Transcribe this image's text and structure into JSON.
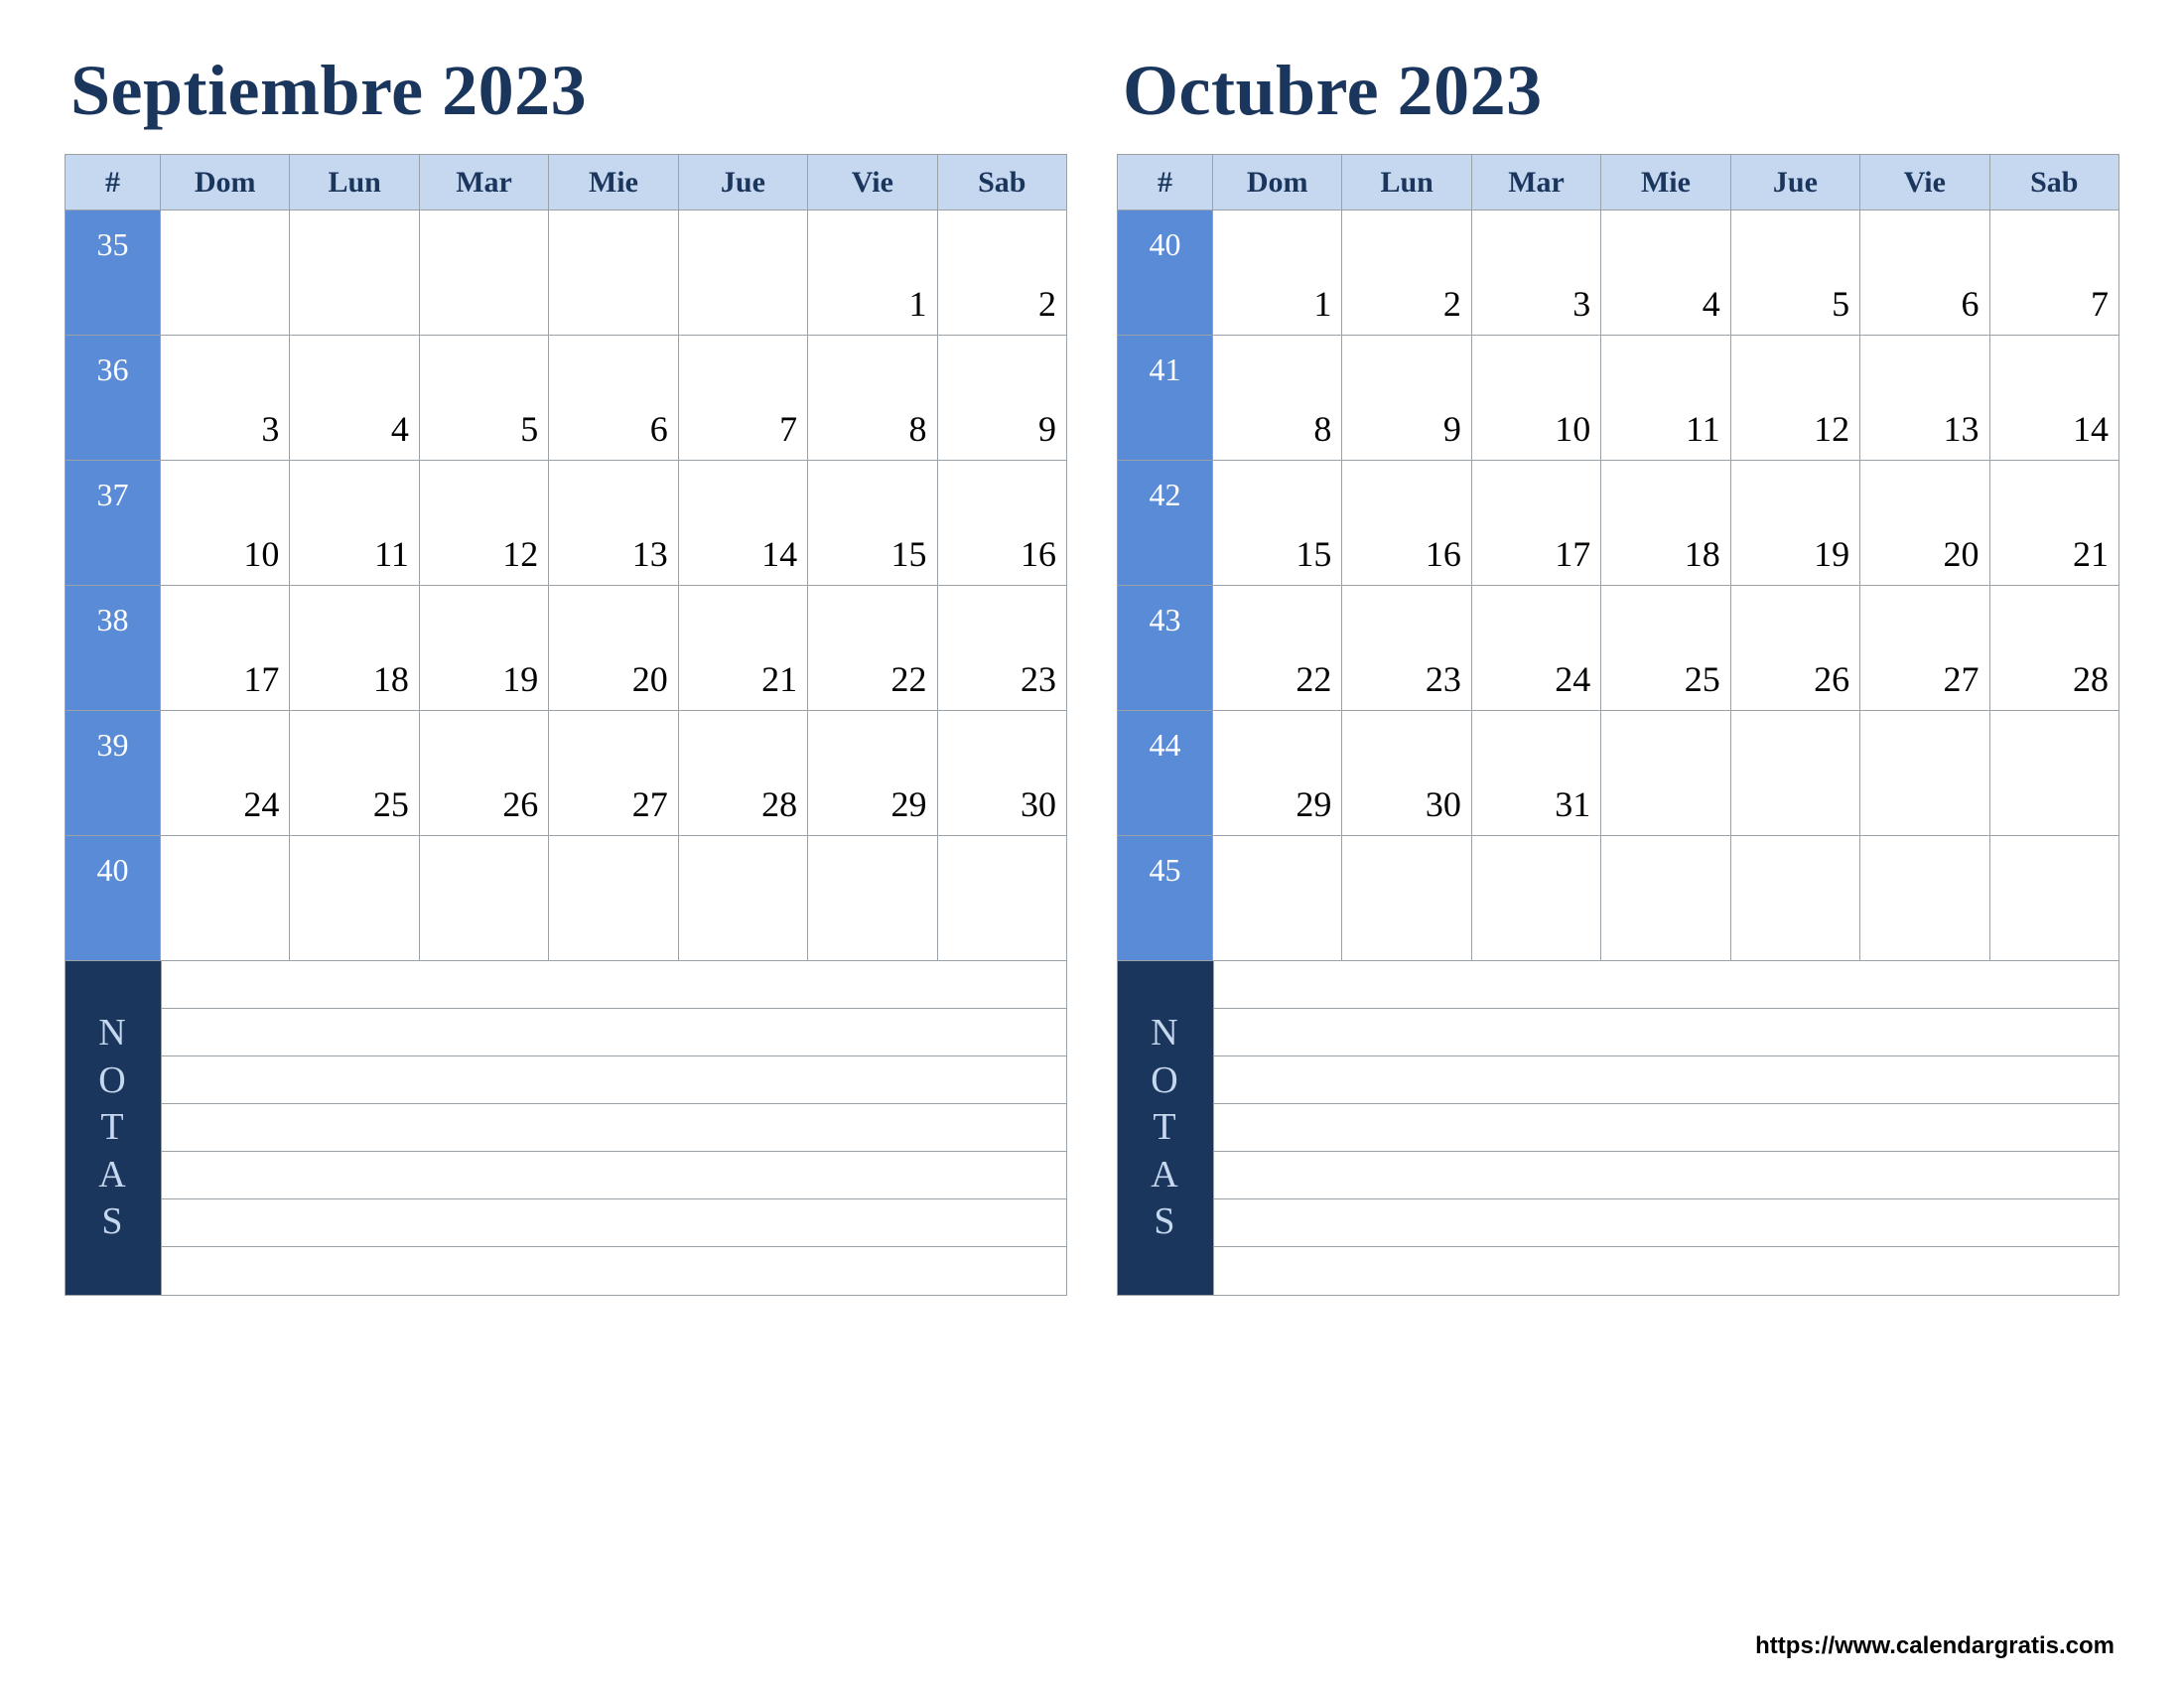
{
  "day_headers": [
    "Dom",
    "Lun",
    "Mar",
    "Mie",
    "Jue",
    "Vie",
    "Sab"
  ],
  "week_hdr": "#",
  "notes_label": "NOTAS",
  "note_line_count": 7,
  "footer_url": "https://www.calendargratis.com",
  "months": [
    {
      "title": "Septiembre 2023",
      "weeks": [
        {
          "num": "35",
          "days": [
            "",
            "",
            "",
            "",
            "",
            "1",
            "2"
          ]
        },
        {
          "num": "36",
          "days": [
            "3",
            "4",
            "5",
            "6",
            "7",
            "8",
            "9"
          ]
        },
        {
          "num": "37",
          "days": [
            "10",
            "11",
            "12",
            "13",
            "14",
            "15",
            "16"
          ]
        },
        {
          "num": "38",
          "days": [
            "17",
            "18",
            "19",
            "20",
            "21",
            "22",
            "23"
          ]
        },
        {
          "num": "39",
          "days": [
            "24",
            "25",
            "26",
            "27",
            "28",
            "29",
            "30"
          ]
        },
        {
          "num": "40",
          "days": [
            "",
            "",
            "",
            "",
            "",
            "",
            ""
          ]
        }
      ]
    },
    {
      "title": "Octubre 2023",
      "weeks": [
        {
          "num": "40",
          "days": [
            "1",
            "2",
            "3",
            "4",
            "5",
            "6",
            "7"
          ]
        },
        {
          "num": "41",
          "days": [
            "8",
            "9",
            "10",
            "11",
            "12",
            "13",
            "14"
          ]
        },
        {
          "num": "42",
          "days": [
            "15",
            "16",
            "17",
            "18",
            "19",
            "20",
            "21"
          ]
        },
        {
          "num": "43",
          "days": [
            "22",
            "23",
            "24",
            "25",
            "26",
            "27",
            "28"
          ]
        },
        {
          "num": "44",
          "days": [
            "29",
            "30",
            "31",
            "",
            "",
            "",
            ""
          ]
        },
        {
          "num": "45",
          "days": [
            "",
            "",
            "",
            "",
            "",
            "",
            ""
          ]
        }
      ]
    }
  ]
}
